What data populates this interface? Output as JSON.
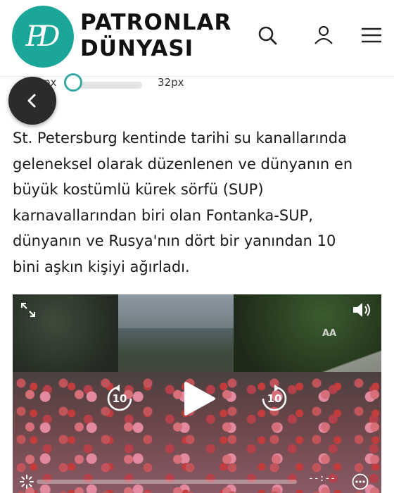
{
  "header": {
    "logo_initials": "PD",
    "brand_line1": "PATRONLAR",
    "brand_line2": "DÜNYASI",
    "icons": [
      "search-icon",
      "user-icon",
      "menu-icon"
    ]
  },
  "font_size_control": {
    "min_label": "px",
    "max_label": "32px"
  },
  "back_button": {
    "icon": "chevron-left-icon"
  },
  "article": {
    "lines": [
      "St. Petersburg kentinde tarihi su kanallarında",
      "geleneksel olarak düzenlenen ve dünyanın en",
      "büyük kostümlü kürek sörfü (SUP)",
      "karnavallarından biri olan Fontanka-SUP,",
      "dünyanın ve Rusya'nın dört bir yanından 10",
      "bini aşkın kişiyi ağırladı."
    ]
  },
  "video": {
    "time_display": "--:--",
    "icons": [
      "fullscreen-icon",
      "volume-icon",
      "rewind-10-icon",
      "play-icon",
      "forward-10-icon",
      "settings-icon",
      "more-icon"
    ],
    "rewind_label": "10",
    "forward_label": "10",
    "watermark": "AA"
  },
  "colors": {
    "brand_teal": "#1aa79a",
    "slider_accent": "#3aa8a6",
    "back_button_bg": "#2b2b2b"
  }
}
